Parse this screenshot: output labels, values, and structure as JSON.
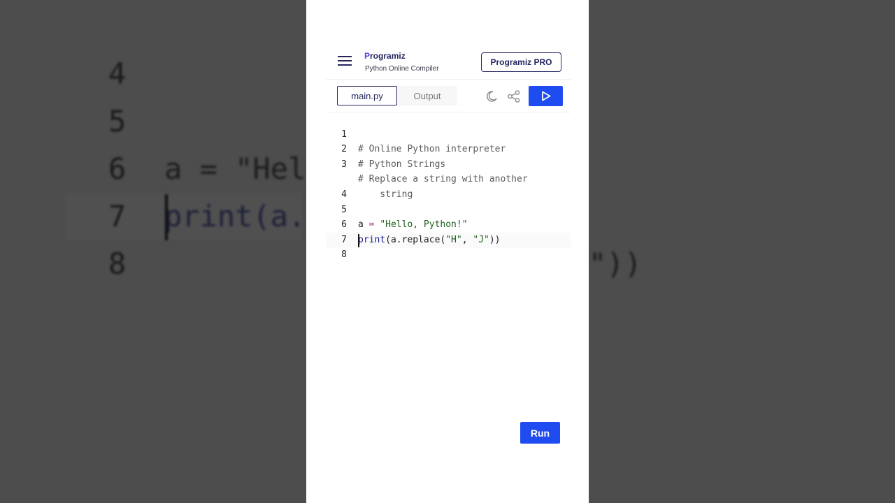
{
  "header": {
    "logo_text": "rogramiz",
    "logo_mark": "P",
    "subtitle": "Python Online Compiler",
    "pro_button": "Programiz PRO"
  },
  "tabs": {
    "main": "main.py",
    "output": "Output"
  },
  "editor": {
    "lines": [
      {
        "num": "1",
        "text": "# Online Python interpreter"
      },
      {
        "num": "2",
        "text": "# Python Strings"
      },
      {
        "num": "3",
        "text": "# Replace a string with another"
      },
      {
        "num": "",
        "text": "    string"
      },
      {
        "num": "4",
        "text": ""
      },
      {
        "num": "5",
        "text": "a = \"Hello, Python!\""
      },
      {
        "num": "6",
        "text": "print(a.replace(\"H\", \"J\"))"
      },
      {
        "num": "7",
        "text": ""
      },
      {
        "num": "8",
        "text": ""
      }
    ],
    "active_line": "8"
  },
  "run_button": "Run",
  "background_zoom": {
    "lines": [
      {
        "num": "4",
        "text": ""
      },
      {
        "num": "5",
        "text": "a = \"Hel"
      },
      {
        "num": "6",
        "text": "print(a."
      },
      {
        "num": "7",
        "text": ""
      },
      {
        "num": "8",
        "text": ""
      }
    ],
    "right_fragment": "\"))"
  },
  "icons": [
    "hamburger-menu-icon",
    "moon-icon",
    "share-icon",
    "play-icon"
  ],
  "colors": {
    "accent": "#1f4cf0",
    "brand_dark": "#25265e"
  }
}
